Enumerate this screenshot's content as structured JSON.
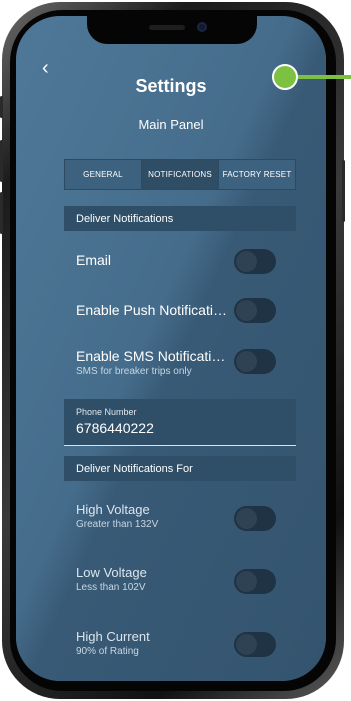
{
  "header": {
    "back_icon": "chevron-left-icon",
    "back_glyph": "‹",
    "title": "Settings",
    "subtitle": "Main Panel"
  },
  "tabs": [
    {
      "label": "GENERAL",
      "active": false
    },
    {
      "label": "NOTIFICATIONS",
      "active": true
    },
    {
      "label": "FACTORY RESET",
      "active": false
    }
  ],
  "deliver_section": {
    "title": "Deliver Notifications",
    "items": [
      {
        "label": "Email",
        "sub": "",
        "enabled": false
      },
      {
        "label": "Enable Push Notificati…",
        "sub": "",
        "enabled": false
      },
      {
        "label": "Enable SMS Notificati…",
        "sub": "SMS for breaker trips only",
        "enabled": false
      }
    ]
  },
  "phone": {
    "label": "Phone Number",
    "value": "6786440222"
  },
  "for_section": {
    "title": "Deliver Notifications For",
    "items": [
      {
        "label": "High Voltage",
        "sub": "Greater than 132V",
        "enabled": false
      },
      {
        "label": "Low Voltage",
        "sub": "Less than 102V",
        "enabled": false
      },
      {
        "label": "High Current",
        "sub": "90% of Rating",
        "enabled": false
      }
    ]
  },
  "colors": {
    "screen_bg": "#3f6584",
    "section_bg": "#2f4f68",
    "toggle_off": "#1f3344",
    "callout": "#7dc142"
  }
}
